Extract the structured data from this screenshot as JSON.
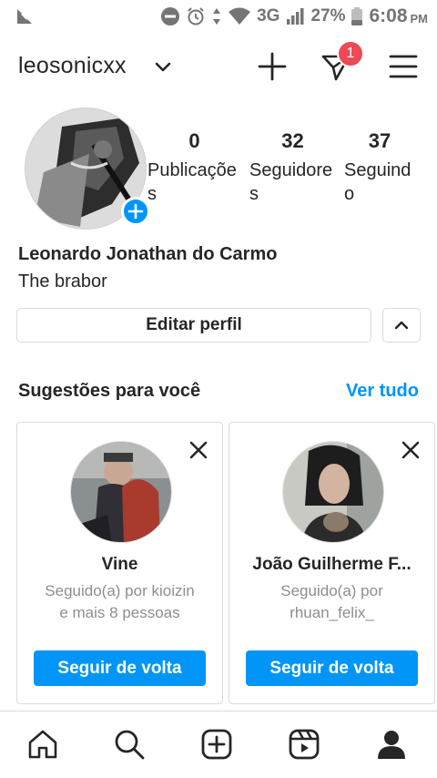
{
  "status_bar": {
    "network": "3G",
    "battery": "27%",
    "time": "6:08",
    "ampm": "PM",
    "icons": [
      "app-logo-icon",
      "do-not-disturb-icon",
      "alarm-icon",
      "data-arrows-icon",
      "wifi-icon",
      "signal-icon",
      "battery-icon"
    ]
  },
  "header": {
    "username": "leosonicxx",
    "dm_badge_count": "1",
    "icons": [
      "chevron-down-icon",
      "plus-icon",
      "direct-message-icon",
      "menu-icon"
    ]
  },
  "profile": {
    "stats": [
      {
        "value": "0",
        "label": "Publicações"
      },
      {
        "value": "32",
        "label": "Seguidores"
      },
      {
        "value": "37",
        "label": "Seguindo"
      }
    ],
    "full_name": "Leonardo Jonathan do Carmo",
    "bio": "The brabor",
    "edit_label": "Editar perfil"
  },
  "suggestions": {
    "title": "Sugestões para você",
    "see_all": "Ver tudo",
    "cards": [
      {
        "name": "Vine",
        "sub_line1": "Seguido(a) por kioizin",
        "sub_line2": "e mais 8 pessoas",
        "button": "Seguir de volta"
      },
      {
        "name": "João Guilherme F...",
        "sub_line1": "Seguido(a) por",
        "sub_line2": "rhuan_felix_",
        "button": "Seguir de volta"
      }
    ]
  },
  "bottom_nav": {
    "items": [
      "home-icon",
      "search-icon",
      "new-post-icon",
      "reels-icon",
      "profile-icon"
    ]
  },
  "colors": {
    "accent": "#0095f6",
    "badge": "#ed4956",
    "text": "#262626",
    "muted": "#8e8e8e",
    "border": "#dbdbdb"
  }
}
